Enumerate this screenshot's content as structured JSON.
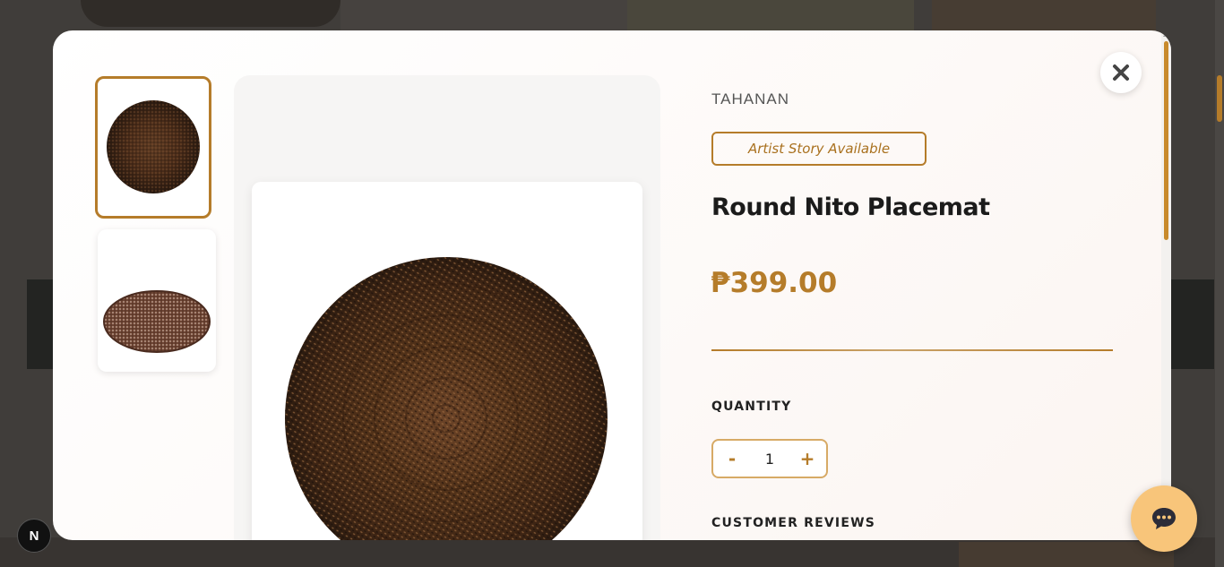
{
  "product": {
    "brand": "TAHANAN",
    "artist_story_label": "Artist Story Available",
    "title": "Round Nito Placemat",
    "price": "₱399.00"
  },
  "quantity": {
    "label": "QUANTITY",
    "decrement": "-",
    "value": "1",
    "increment": "+"
  },
  "reviews": {
    "label": "CUSTOMER REVIEWS"
  },
  "icons": {
    "close": "close-icon",
    "chat": "chat-icon",
    "framework_badge": "N"
  },
  "colors": {
    "accent": "#b57c2a",
    "chat_button": "#f8c57a",
    "title": "#1b1b1b"
  }
}
